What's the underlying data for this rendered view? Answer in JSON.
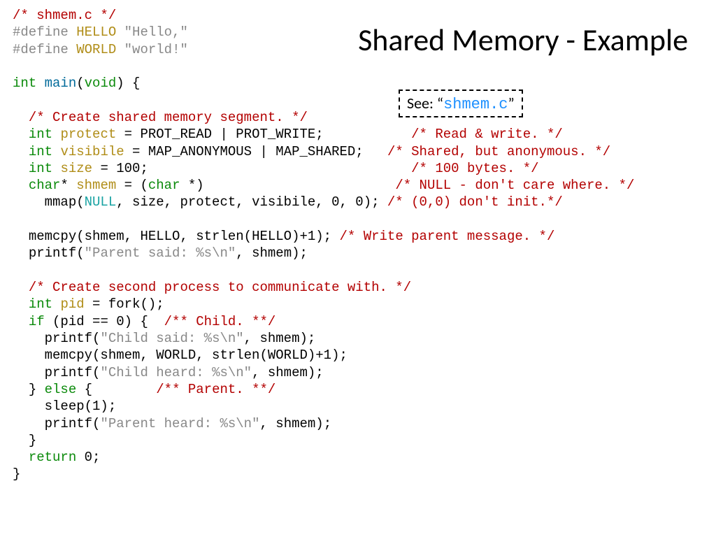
{
  "title": "Shared Memory - Example",
  "see": {
    "prefix": "See: “",
    "file": "shmem.c",
    "suffix": "”"
  },
  "code": {
    "l1": "/* shmem.c */",
    "l2a": "#define",
    "l2b": "HELLO",
    "l2c": "\"Hello,\"",
    "l3a": "#define",
    "l3b": "WORLD",
    "l3c": "\"world!\"",
    "l5a": "int",
    "l5b": "main",
    "l5c": "(",
    "l5d": "void",
    "l5e": ") {",
    "l7": "/* Create shared memory segment. */",
    "l8a": "int",
    "l8b": "protect",
    "l8c": " = PROT_READ | PROT_WRITE;",
    "l8d": "/* Read & write. */",
    "l9a": "int",
    "l9b": "visibile",
    "l9c": " = MAP_ANONYMOUS | MAP_SHARED;",
    "l9d": "/* Shared, but anonymous. */",
    "l10a": "int",
    "l10b": "size",
    "l10c": " = 100;",
    "l10d": "/* 100 bytes. */",
    "l11a": "char",
    "l11b": "*",
    "l11c": "shmem",
    "l11d": " = (",
    "l11e": "char",
    "l11f": " *)",
    "l11g": "/* NULL - don't care where. */",
    "l12a": "mmap(",
    "l12b": "NULL",
    "l12c": ", size, protect, visibile, 0, 0); ",
    "l12d": "/* (0,0) don't init.*/",
    "l14a": "memcpy(shmem, HELLO, strlen(HELLO)+1); ",
    "l14b": "/* Write parent message. */",
    "l15a": "printf(",
    "l15b": "\"Parent said: %s\\n\"",
    "l15c": ", shmem);",
    "l17": "/* Create second process to communicate with. */",
    "l18a": "int",
    "l18b": "pid",
    "l18c": " = fork();",
    "l19a": "if",
    "l19b": " (pid == 0) {  ",
    "l19c": "/** Child. **/",
    "l20a": "printf(",
    "l20b": "\"Child said: %s\\n\"",
    "l20c": ", shmem);",
    "l21": "memcpy(shmem, WORLD, strlen(WORLD)+1);",
    "l22a": "printf(",
    "l22b": "\"Child heard: %s\\n\"",
    "l22c": ", shmem);",
    "l23a": "} ",
    "l23b": "else",
    "l23c": " {        ",
    "l23d": "/** Parent. **/",
    "l24": "sleep(1);",
    "l25a": "printf(",
    "l25b": "\"Parent heard: %s\\n\"",
    "l25c": ", shmem);",
    "l26": "}",
    "l27a": "return",
    "l27b": " 0;",
    "l28": "}"
  }
}
